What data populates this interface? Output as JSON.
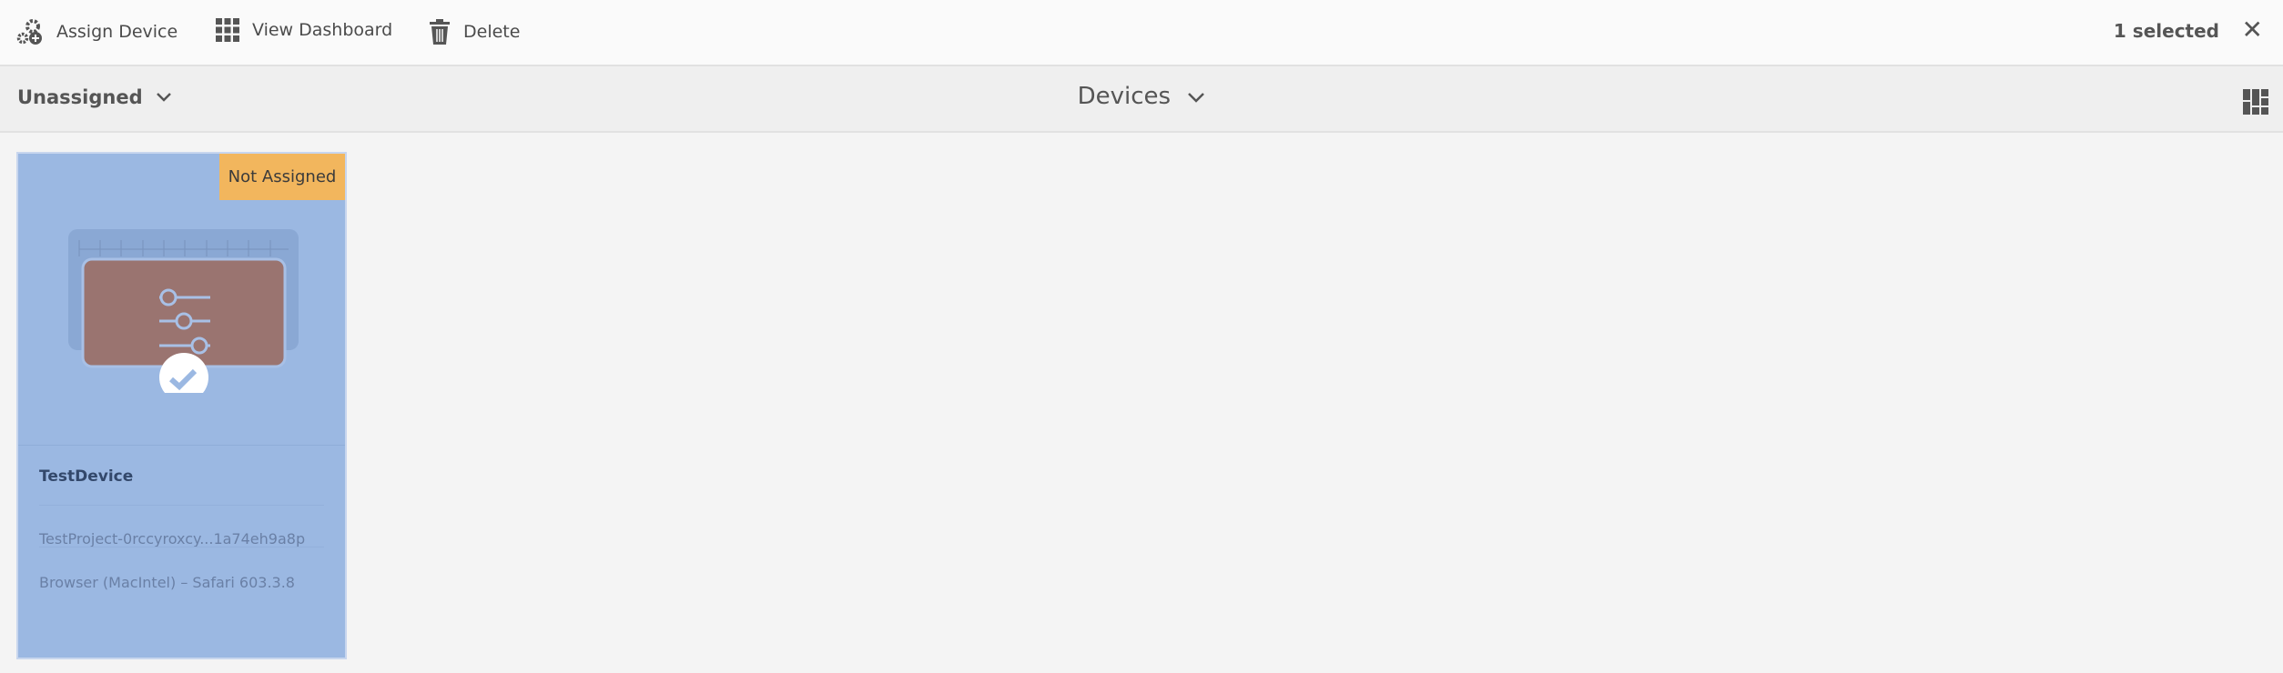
{
  "toolbar": {
    "assign_device": "Assign Device",
    "view_dashboard": "View Dashboard",
    "delete": "Delete",
    "selected_count": "1 selected"
  },
  "subbar": {
    "filter": "Unassigned",
    "title": "Devices"
  },
  "devices": [
    {
      "status": "Not Assigned",
      "name": "TestDevice",
      "project": "TestProject-0rccyroxcy...1a74eh9a8p",
      "browser": "Browser (MacIntel) – Safari 603.3.8",
      "selected": true
    }
  ],
  "colors": {
    "selected_card": "#9bb8e2",
    "badge": "#f2b65d"
  }
}
